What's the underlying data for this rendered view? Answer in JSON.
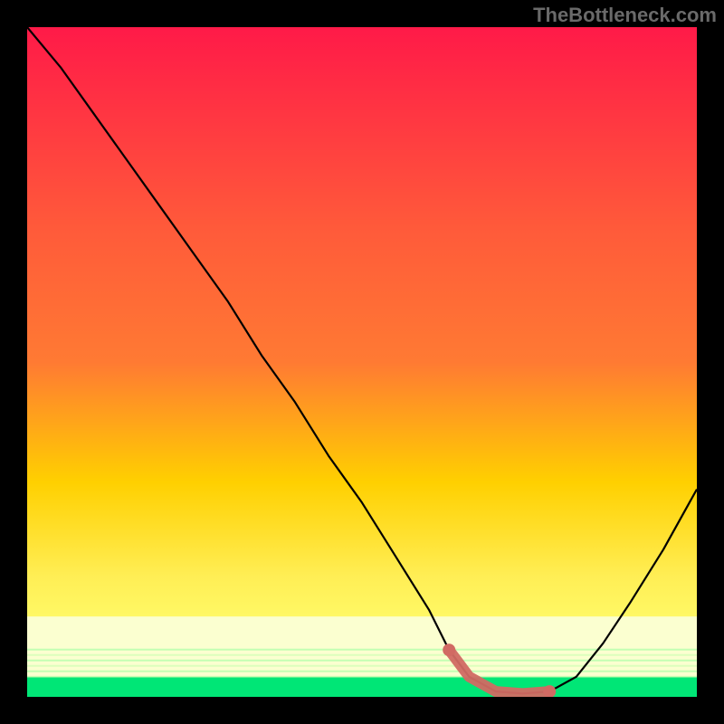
{
  "watermark": "TheBottleneck.com",
  "chart_data": {
    "type": "line",
    "title": "",
    "xlabel": "",
    "ylabel": "",
    "xlim": [
      0,
      100
    ],
    "ylim": [
      0,
      100
    ],
    "background_gradient": {
      "top": "#ff1a48",
      "upper_mid": "#ff7a33",
      "mid": "#ffd000",
      "lower_mid": "#ffff6e",
      "bottom": "#00e676"
    },
    "series": [
      {
        "name": "bottleneck-curve",
        "color": "#000000",
        "x": [
          0,
          5,
          10,
          15,
          20,
          25,
          30,
          35,
          40,
          45,
          50,
          55,
          60,
          63,
          66,
          70,
          74,
          78,
          82,
          86,
          90,
          95,
          100
        ],
        "y": [
          100,
          94,
          87,
          80,
          73,
          66,
          59,
          51,
          44,
          36,
          29,
          21,
          13,
          7,
          3,
          0.8,
          0.5,
          0.8,
          3,
          8,
          14,
          22,
          31
        ]
      },
      {
        "name": "optimal-range-marker",
        "color": "#d16a63",
        "x": [
          63,
          66,
          70,
          74,
          78
        ],
        "y": [
          7,
          3,
          0.8,
          0.5,
          0.8
        ]
      }
    ],
    "green_band_y": [
      0,
      3
    ],
    "pale_band_y": [
      3,
      12
    ]
  }
}
